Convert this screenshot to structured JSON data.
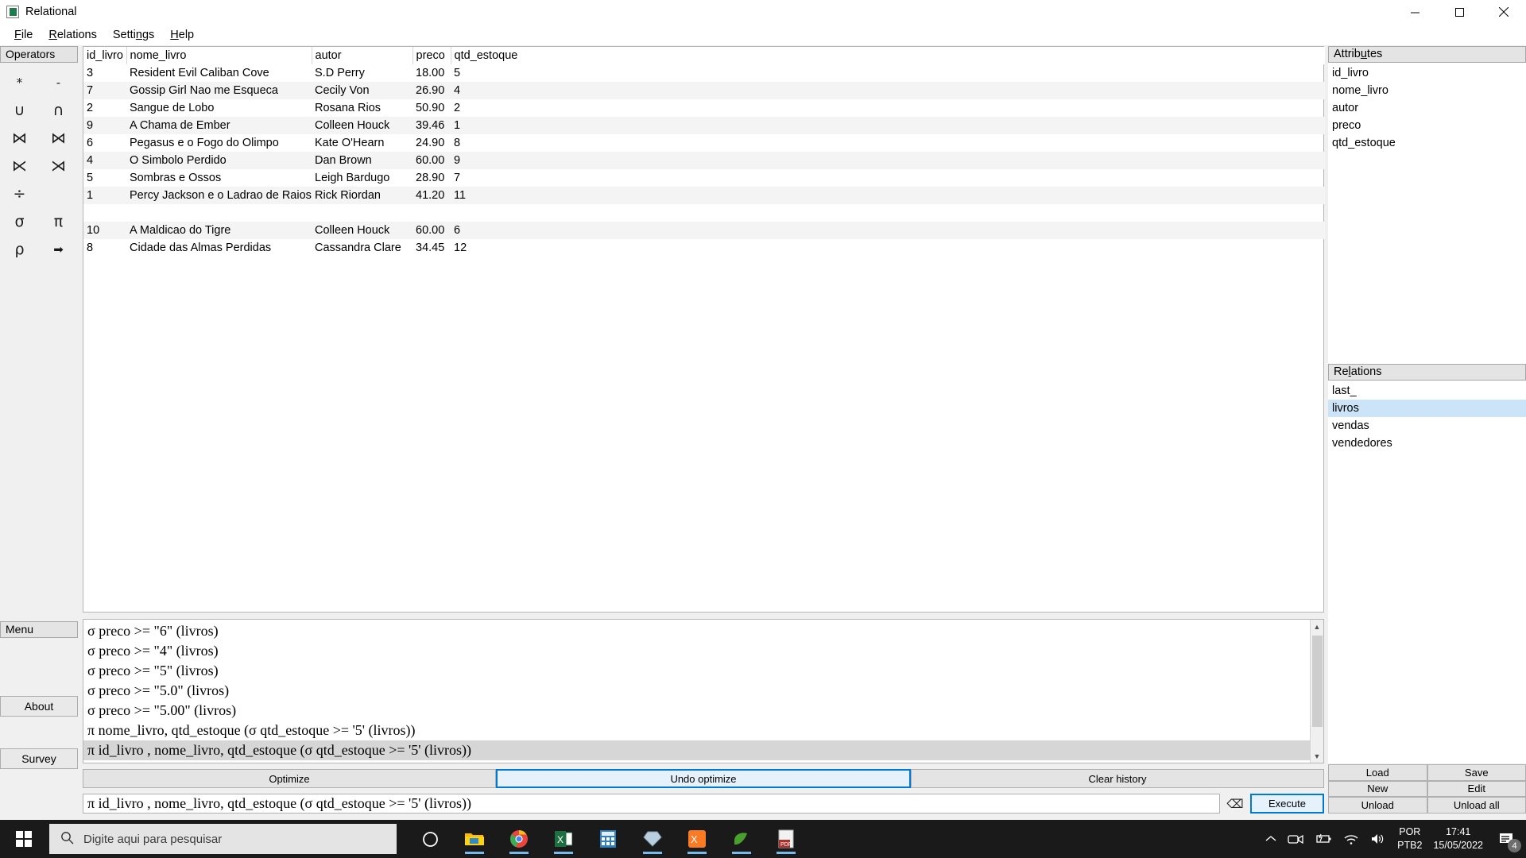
{
  "window": {
    "title": "Relational",
    "icon": "app-icon",
    "minimize_label": "—",
    "maximize_label": "☐",
    "close_label": "✕"
  },
  "menubar": {
    "items": [
      {
        "label": "File",
        "mnemonic": "F"
      },
      {
        "label": "Relations",
        "mnemonic": "R"
      },
      {
        "label": "Settings",
        "mnemonic": "n"
      },
      {
        "label": "Help",
        "mnemonic": "H"
      }
    ]
  },
  "operators": {
    "header": "Operators",
    "items": [
      {
        "symbol": "*",
        "name": "product"
      },
      {
        "symbol": "-",
        "name": "difference"
      },
      {
        "symbol": "∪",
        "name": "union"
      },
      {
        "symbol": "∩",
        "name": "intersection"
      },
      {
        "symbol": "⋈",
        "name": "natural-join"
      },
      {
        "symbol": "⋈",
        "name": "theta-join"
      },
      {
        "symbol": "⋉",
        "name": "left-outer-join"
      },
      {
        "symbol": "⋊",
        "name": "right-outer-join"
      },
      {
        "symbol": "÷",
        "name": "division"
      },
      {
        "symbol": "",
        "name": "empty"
      },
      {
        "symbol": "σ",
        "name": "selection"
      },
      {
        "symbol": "π",
        "name": "projection"
      },
      {
        "symbol": "ρ",
        "name": "rename"
      },
      {
        "symbol": "➡",
        "name": "arrow"
      }
    ]
  },
  "menu_panel": {
    "header": "Menu",
    "about_label": "About",
    "survey_label": "Survey"
  },
  "table": {
    "columns": [
      "id_livro",
      "nome_livro",
      "autor",
      "preco",
      "qtd_estoque"
    ],
    "rows": [
      [
        "3",
        "Resident Evil Caliban Cove",
        "S.D Perry",
        "18.00",
        "5"
      ],
      [
        "7",
        "Gossip Girl Nao me Esqueca",
        "Cecily Von",
        "26.90",
        "4"
      ],
      [
        "2",
        "Sangue de Lobo",
        "Rosana Rios",
        "50.90",
        "2"
      ],
      [
        "9",
        "A Chama de Ember",
        "Colleen Houck",
        "39.46",
        "1"
      ],
      [
        "6",
        "Pegasus e o Fogo do Olimpo",
        "Kate O'Hearn",
        "24.90",
        "8"
      ],
      [
        "4",
        "O Simbolo Perdido",
        "Dan Brown",
        "60.00",
        "9"
      ],
      [
        "5",
        "Sombras e Ossos",
        "Leigh Bardugo",
        "28.90",
        "7"
      ],
      [
        "1",
        "Percy Jackson e o Ladrao de Raios",
        "Rick Riordan",
        "41.20",
        "11"
      ],
      [
        "",
        "",
        "",
        "",
        ""
      ],
      [
        "10",
        "A Maldicao do Tigre",
        "Colleen Houck",
        "60.00",
        "6"
      ],
      [
        "8",
        "Cidade das Almas Perdidas",
        "Cassandra Clare",
        "34.45",
        "12"
      ]
    ]
  },
  "history": {
    "entries": [
      "σ preco >= \"6\" (livros)",
      "σ preco >= \"4\" (livros)",
      "σ preco >= \"5\" (livros)",
      "σ preco >= \"5.0\" (livros)",
      "σ preco >= \"5.00\" (livros)",
      "π nome_livro, qtd_estoque (σ qtd_estoque >= '5' (livros))",
      "π id_livro , nome_livro, qtd_estoque (σ qtd_estoque >= '5' (livros))"
    ],
    "selected_index": 6,
    "scroll_up": "▲",
    "scroll_down": "▼"
  },
  "toolbar": {
    "optimize_label": "Optimize",
    "undo_optimize_label": "Undo optimize",
    "clear_history_label": "Clear history"
  },
  "query": {
    "value": "π id_livro , nome_livro, qtd_estoque (σ qtd_estoque >= '5' (livros))",
    "clear_icon": "⌫",
    "execute_label": "Execute"
  },
  "attributes": {
    "header": "Attributes",
    "header_pre": "Attrib",
    "header_mnemonic": "u",
    "header_post": "tes",
    "items": [
      "id_livro",
      "nome_livro",
      "autor",
      "preco",
      "qtd_estoque"
    ]
  },
  "relations": {
    "header": "Relations",
    "header_pre": "Re",
    "header_mnemonic": "l",
    "header_post": "ations",
    "items": [
      "last_",
      "livros",
      "vendas",
      "vendedores"
    ],
    "selected": "livros"
  },
  "relation_buttons": {
    "load": "Load",
    "save": "Save",
    "new": "New",
    "edit": "Edit",
    "unload": "Unload",
    "unload_all": "Unload all"
  },
  "taskbar": {
    "search_placeholder": "Digite aqui para pesquisar",
    "language": "POR",
    "keyboard": "PTB2",
    "time": "17:41",
    "date": "15/05/2022",
    "notification_count": "4",
    "apps": [
      "cortana-icon",
      "file-explorer-icon",
      "chrome-icon",
      "excel-icon",
      "calculator-icon",
      "gem-icon",
      "xampp-icon",
      "mint-icon",
      "pdf-icon"
    ]
  },
  "colors": {
    "accent": "#0078d7",
    "selection": "#cce4f7",
    "history_selection": "#d6d6d6",
    "panel": "#f0f0f0",
    "taskbar": "#1a1a1a"
  }
}
